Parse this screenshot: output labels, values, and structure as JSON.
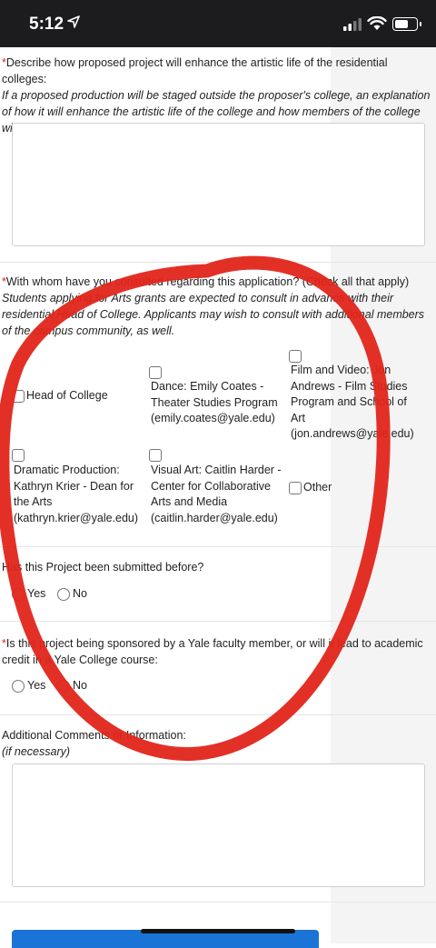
{
  "status_bar": {
    "time": "5:12"
  },
  "q_enhance": {
    "asterisk": "*",
    "label": "Describe how proposed project will enhance the artistic life of the residential colleges:",
    "hint": "If a proposed production will be staged outside the proposer's college, an explanation of how it will enhance the artistic life of the college and how members of the college will be involved should be included in the proposal."
  },
  "q_consulted": {
    "asterisk": "*",
    "label": "With whom have you consulted regarding this application? (Check all that apply)",
    "hint": "Students applying for Arts grants are expected to consult in advance with their residential Head of College. Applicants may wish to consult with additional members of the campus community, as well.",
    "options": [
      "Head of College",
      "Dance: Emily Coates - Theater Studies Program (emily.coates@yale.edu)",
      "Film and Video: Jon Andrews - Film Studies Program and School of Art (jon.andrews@yale.edu)",
      "Dramatic Production: Kathryn Krier - Dean for the Arts (kathryn.krier@yale.edu)",
      "Visual Art: Caitlin Harder - Center for Collaborative Arts and Media (caitlin.harder@yale.edu)",
      "Other"
    ]
  },
  "q_submitted": {
    "label": "Has this Project been submitted before?",
    "yes": "Yes",
    "no": "No"
  },
  "q_sponsored": {
    "asterisk": "*",
    "label": "Is this project being sponsored by a Yale faculty member, or will it lead to academic credit in a Yale College course:",
    "yes": "Yes",
    "no": "No"
  },
  "q_comments": {
    "label": "Additional Comments or Information:",
    "hint": "(if necessary)"
  },
  "colors": {
    "required": "#dd2222",
    "annotation": "#e2251b",
    "submit": "#1a73d6"
  }
}
